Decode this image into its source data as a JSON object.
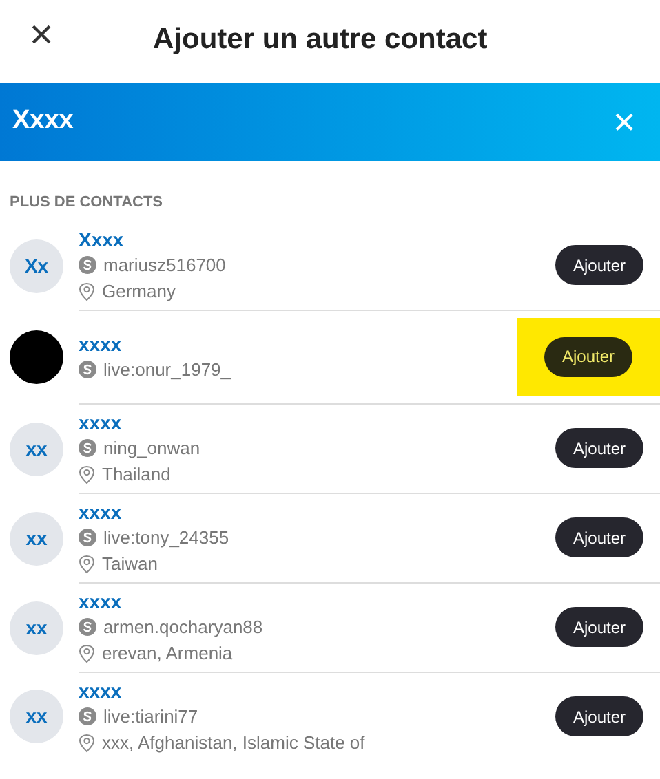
{
  "header": {
    "close": "×",
    "title": "Ajouter un autre contact"
  },
  "search": {
    "value": "Xxxx",
    "clear": "×"
  },
  "section_label": "PLUS DE CONTACTS",
  "contacts": [
    {
      "avatar": {
        "kind": "initials",
        "text": "Xx"
      },
      "name": "Xxxx",
      "skype_id": "mariusz516700",
      "location": "Germany",
      "button": "Ajouter",
      "highlighted": false
    },
    {
      "avatar": {
        "kind": "image"
      },
      "name": "xxxx",
      "skype_id": "live:onur_1979_",
      "button": "Ajouter",
      "highlighted": true
    },
    {
      "avatar": {
        "kind": "initials",
        "text": "xx"
      },
      "name": "xxxx",
      "skype_id": "ning_onwan",
      "location": "Thailand",
      "button": "Ajouter",
      "highlighted": false
    },
    {
      "avatar": {
        "kind": "initials",
        "text": "xx"
      },
      "name": "xxxx",
      "skype_id": "live:tony_24355",
      "location": "Taiwan",
      "button": "Ajouter",
      "highlighted": false
    },
    {
      "avatar": {
        "kind": "initials",
        "text": "xx"
      },
      "name": "xxxx",
      "skype_id": "armen.qocharyan88",
      "location": "erevan, Armenia",
      "button": "Ajouter",
      "highlighted": false
    },
    {
      "avatar": {
        "kind": "initials",
        "text": "xx"
      },
      "name": "xxxx",
      "skype_id": "live:tiarini77",
      "location": "xxx, Afghanistan, Islamic State of",
      "button": "Ajouter",
      "highlighted": false
    }
  ]
}
